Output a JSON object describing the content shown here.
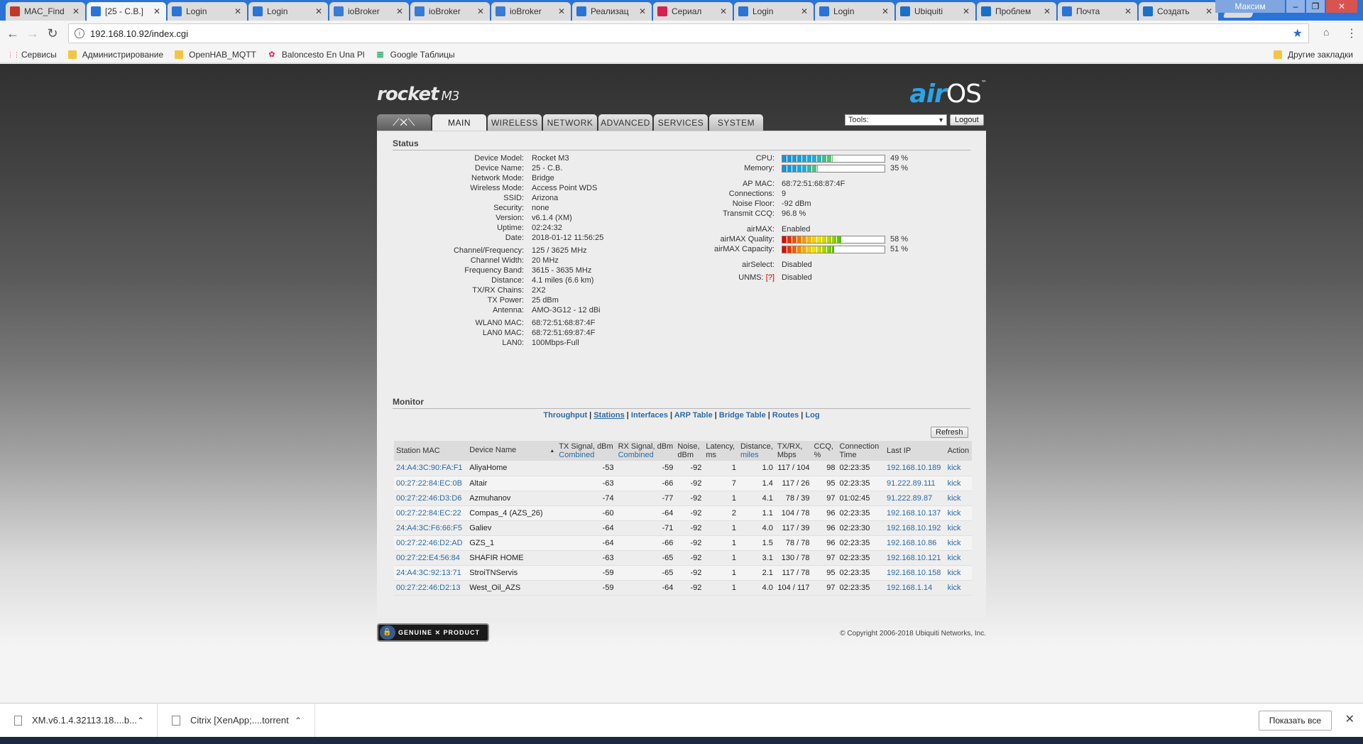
{
  "browser": {
    "tabs": [
      {
        "title": "MAC_Find",
        "icon": "mac-find-icon",
        "color": "#c0392b"
      },
      {
        "title": "[25 - C.B.]",
        "icon": "ubnt-icon",
        "color": "#2a73d8",
        "active": true
      },
      {
        "title": "Login",
        "icon": "ubnt-icon",
        "color": "#2a73d8"
      },
      {
        "title": "Login",
        "icon": "ubnt-icon",
        "color": "#2a73d8"
      },
      {
        "title": "ioBroker",
        "icon": "iobroker-icon",
        "color": "#3a7bd5"
      },
      {
        "title": "ioBroker",
        "icon": "iobroker-icon",
        "color": "#3a7bd5"
      },
      {
        "title": "ioBroker",
        "icon": "iobroker-icon",
        "color": "#3a7bd5"
      },
      {
        "title": "Реализац",
        "icon": "ubnt-icon",
        "color": "#2a73d8"
      },
      {
        "title": "Сериал",
        "icon": "ivi-icon",
        "color": "#d6204e"
      },
      {
        "title": "Login",
        "icon": "ubnt-icon",
        "color": "#2a73d8"
      },
      {
        "title": "Login",
        "icon": "ubnt-icon",
        "color": "#2a73d8"
      },
      {
        "title": "Ubiquiti",
        "icon": "ubiquiti-icon",
        "color": "#1a6fc8"
      },
      {
        "title": "Проблем",
        "icon": "ubiquiti-icon",
        "color": "#1a6fc8"
      },
      {
        "title": "Почта",
        "icon": "mail-icon",
        "color": "#2a73d8"
      },
      {
        "title": "Создать",
        "icon": "ubiquiti-icon",
        "color": "#1a6fc8"
      }
    ],
    "tab_close": "✕",
    "user": "Максим",
    "url": "192.168.10.92/index.cgi",
    "bookmarks": [
      {
        "label": "Сервисы",
        "icon": "apps-icon"
      },
      {
        "label": "Администрирование",
        "icon": "folder-icon"
      },
      {
        "label": "OpenHAB_MQTT",
        "icon": "folder-icon"
      },
      {
        "label": "Baloncesto En Una Pl",
        "icon": "flower-icon"
      },
      {
        "label": "Google Таблицы",
        "icon": "sheets-icon"
      }
    ],
    "other_bookmarks": "Другие закладки"
  },
  "airos": {
    "product": "rocket",
    "model_suffix": "M3",
    "brand_air": "air",
    "brand_os": "OS",
    "tm": "™",
    "tabs": [
      "MAIN",
      "WIRELESS",
      "NETWORK",
      "ADVANCED",
      "SERVICES",
      "SYSTEM"
    ],
    "tools_label": "Tools:",
    "logout_label": "Logout",
    "status_title": "Status",
    "left": [
      {
        "k": "Device Model:",
        "v": "Rocket M3"
      },
      {
        "k": "Device Name:",
        "v": "25 - C.B."
      },
      {
        "k": "Network Mode:",
        "v": "Bridge"
      },
      {
        "k": "Wireless Mode:",
        "v": "Access Point WDS"
      },
      {
        "k": "SSID:",
        "v": "Arizona"
      },
      {
        "k": "Security:",
        "v": "none"
      },
      {
        "k": "Version:",
        "v": "v6.1.4 (XM)"
      },
      {
        "k": "Uptime:",
        "v": "02:24:32"
      },
      {
        "k": "Date:",
        "v": "2018-01-12 11:56:25"
      },
      {
        "k": "Channel/Frequency:",
        "v": "125 / 3625 MHz"
      },
      {
        "k": "Channel Width:",
        "v": "20 MHz"
      },
      {
        "k": "Frequency Band:",
        "v": "3615 - 3635 MHz"
      },
      {
        "k": "Distance:",
        "v": "4.1 miles (6.6 km)"
      },
      {
        "k": "TX/RX Chains:",
        "v": "2X2"
      },
      {
        "k": "TX Power:",
        "v": "25 dBm"
      },
      {
        "k": "Antenna:",
        "v": "AMO-3G12 - 12 dBi"
      },
      {
        "k": "WLAN0 MAC:",
        "v": "68:72:51:68:87:4F"
      },
      {
        "k": "LAN0 MAC:",
        "v": "68:72:51:69:87:4F"
      },
      {
        "k": "LAN0:",
        "v": "100Mbps-Full"
      }
    ],
    "right": {
      "cpu_label": "CPU:",
      "cpu_pct": 49,
      "cpu_text": "49 %",
      "mem_label": "Memory:",
      "mem_pct": 35,
      "mem_text": "35 %",
      "ap_mac_label": "AP MAC:",
      "ap_mac": "68:72:51:68:87:4F",
      "connections_label": "Connections:",
      "connections": "9",
      "noise_label": "Noise Floor:",
      "noise": "-92 dBm",
      "ccq_label": "Transmit CCQ:",
      "ccq": "96.8 %",
      "airmax_label": "airMAX:",
      "airmax": "Enabled",
      "amq_label": "airMAX Quality:",
      "amq_pct": 58,
      "amq_text": "58 %",
      "amc_label": "airMAX Capacity:",
      "amc_pct": 51,
      "amc_text": "51 %",
      "airselect_label": "airSelect:",
      "airselect": "Disabled",
      "unms_label": "UNMS:",
      "unms_help": "[?]",
      "unms": "Disabled"
    },
    "monitor_title": "Monitor",
    "monitor_links": [
      "Throughput",
      "Stations",
      "Interfaces",
      "ARP Table",
      "Bridge Table",
      "Routes",
      "Log"
    ],
    "monitor_sep": "|",
    "refresh_label": "Refresh",
    "columns": [
      {
        "h": "Station MAC",
        "s": ""
      },
      {
        "h": "Device Name",
        "s": ""
      },
      {
        "h": "TX Signal, dBm",
        "s": "Combined"
      },
      {
        "h": "RX Signal, dBm",
        "s": "Combined"
      },
      {
        "h": "Noise,",
        "s": "dBm"
      },
      {
        "h": "Latency,",
        "s": "ms"
      },
      {
        "h": "Distance,",
        "s": "miles"
      },
      {
        "h": "TX/RX,",
        "s": "Mbps"
      },
      {
        "h": "CCQ,",
        "s": "%"
      },
      {
        "h": "Connection",
        "s": "Time"
      },
      {
        "h": "Last IP",
        "s": ""
      },
      {
        "h": "Action",
        "s": ""
      }
    ],
    "sort_arrow": "▲",
    "stations": [
      [
        "24:A4:3C:90:FA:F1",
        "AliyaHome",
        "-53",
        "-59",
        "-92",
        "1",
        "1.0",
        "117 / 104",
        "98",
        "02:23:35",
        "192.168.10.189",
        "kick"
      ],
      [
        "00:27:22:84:EC:0B",
        "Altair",
        "-63",
        "-66",
        "-92",
        "7",
        "1.4",
        "117 / 26",
        "95",
        "02:23:35",
        "91.222.89.111",
        "kick"
      ],
      [
        "00:27:22:46:D3:D6",
        "Azmuhanov",
        "-74",
        "-77",
        "-92",
        "1",
        "4.1",
        "78 / 39",
        "97",
        "01:02:45",
        "91.222.89.87",
        "kick"
      ],
      [
        "00:27:22:84:EC:22",
        "Compas_4 (AZS_26)",
        "-60",
        "-64",
        "-92",
        "2",
        "1.1",
        "104 / 78",
        "96",
        "02:23:35",
        "192.168.10.137",
        "kick"
      ],
      [
        "24:A4:3C:F6:66:F5",
        "Galiev",
        "-64",
        "-71",
        "-92",
        "1",
        "4.0",
        "117 / 39",
        "96",
        "02:23:30",
        "192.168.10.192",
        "kick"
      ],
      [
        "00:27:22:46:D2:AD",
        "GZS_1",
        "-64",
        "-66",
        "-92",
        "1",
        "1.5",
        "78 / 78",
        "96",
        "02:23:35",
        "192.168.10.86",
        "kick"
      ],
      [
        "00:27:22:E4:56:84",
        "SHAFIR HOME",
        "-63",
        "-65",
        "-92",
        "1",
        "3.1",
        "130 / 78",
        "97",
        "02:23:35",
        "192.168.10.121",
        "kick"
      ],
      [
        "24:A4:3C:92:13:71",
        "StroiTNServis",
        "-59",
        "-65",
        "-92",
        "1",
        "2.1",
        "117 / 78",
        "95",
        "02:23:35",
        "192.168.10.158",
        "kick"
      ],
      [
        "00:27:22:46:D2:13",
        "West_Oil_AZS",
        "-59",
        "-64",
        "-92",
        "1",
        "4.0",
        "104 / 117",
        "97",
        "02:23:35",
        "192.168.1.14",
        "kick"
      ]
    ],
    "genuine": "GENUINE ✕ PRODUCT",
    "copyright": "© Copyright 2006-2018 Ubiquiti Networks, Inc."
  },
  "downloads": [
    {
      "name": "XM.v6.1.4.32113.18....b..."
    },
    {
      "name": "Citrix [XenApp;....torrent"
    }
  ],
  "show_all": "Показать все"
}
